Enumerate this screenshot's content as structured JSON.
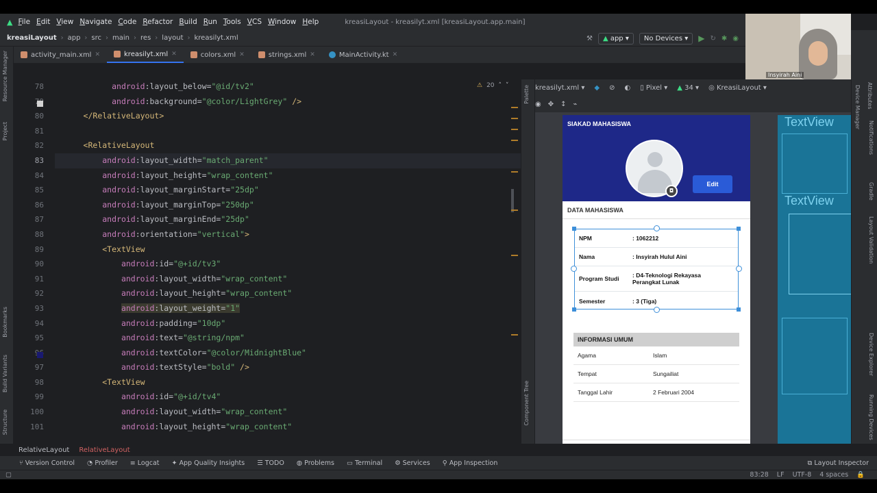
{
  "menu": [
    "File",
    "Edit",
    "View",
    "Navigate",
    "Code",
    "Refactor",
    "Build",
    "Run",
    "Tools",
    "VCS",
    "Window",
    "Help"
  ],
  "window_title": "kreasiLayout - kreasilyt.xml [kreasiLayout.app.main]",
  "breadcrumb": [
    "kreasiLayout",
    "app",
    "src",
    "main",
    "res",
    "layout",
    "kreasilyt.xml"
  ],
  "run": {
    "config": "app",
    "device": "No Devices"
  },
  "tabs": [
    {
      "label": "activity_main.xml",
      "color": "#cf8e6d"
    },
    {
      "label": "kreasilyt.xml",
      "color": "#cf8e6d"
    },
    {
      "label": "colors.xml",
      "color": "#cf8e6d"
    },
    {
      "label": "strings.xml",
      "color": "#cf8e6d"
    },
    {
      "label": "MainActivity.kt",
      "color": "#3592c4"
    }
  ],
  "left_tools": [
    "Resource Manager",
    "Project",
    "Bookmarks",
    "Build Variants",
    "Structure"
  ],
  "inspections": {
    "warnings": "20"
  },
  "line_numbers": [
    "78",
    "79",
    "80",
    "81",
    "82",
    "83",
    "84",
    "85",
    "86",
    "87",
    "88",
    "89",
    "90",
    "91",
    "92",
    "93",
    "94",
    "95",
    "96",
    "97",
    "98",
    "99",
    "100",
    "101"
  ],
  "code": {
    "l78": {
      "indent": "            ",
      "ns": "android",
      "attr": ":layout_below=",
      "val": "\"@id/tv2\""
    },
    "l79": {
      "indent": "            ",
      "ns": "android",
      "attr": ":background=",
      "val": "\"@color/LightGrey\"",
      "tail": " />"
    },
    "l80": {
      "indent": "      ",
      "tag": "</RelativeLayout>"
    },
    "l82": {
      "indent": "      ",
      "tag": "<RelativeLayout"
    },
    "l83": {
      "indent": "          ",
      "ns": "android",
      "attr": ":layout_width=",
      "val": "\"match_parent\""
    },
    "l84": {
      "indent": "          ",
      "ns": "android",
      "attr": ":layout_height=",
      "val": "\"wrap_content\""
    },
    "l85": {
      "indent": "          ",
      "ns": "android",
      "attr": ":layout_marginStart=",
      "val": "\"25dp\""
    },
    "l86": {
      "indent": "          ",
      "ns": "android",
      "attr": ":layout_marginTop=",
      "val": "\"250dp\""
    },
    "l87": {
      "indent": "          ",
      "ns": "android",
      "attr": ":layout_marginEnd=",
      "val": "\"25dp\""
    },
    "l88": {
      "indent": "          ",
      "ns": "android",
      "attr": ":orientation=",
      "val": "\"vertical\"",
      "tail": ">"
    },
    "l89": {
      "indent": "          ",
      "tag": "<TextView"
    },
    "l90": {
      "indent": "              ",
      "ns": "android",
      "attr": ":id=",
      "val": "\"@+id/tv3\""
    },
    "l91": {
      "indent": "              ",
      "ns": "android",
      "attr": ":layout_width=",
      "val": "\"wrap_content\""
    },
    "l92": {
      "indent": "              ",
      "ns": "android",
      "attr": ":layout_height=",
      "val": "\"wrap_content\""
    },
    "l93": {
      "indent": "              ",
      "ns": "android",
      "attr": ":layout_weight=",
      "val": "\"1\""
    },
    "l94": {
      "indent": "              ",
      "ns": "android",
      "attr": ":padding=",
      "val": "\"10dp\""
    },
    "l95": {
      "indent": "              ",
      "ns": "android",
      "attr": ":text=",
      "val": "\"@string/npm\""
    },
    "l96": {
      "indent": "              ",
      "ns": "android",
      "attr": ":textColor=",
      "val": "\"@color/MidnightBlue\""
    },
    "l97": {
      "indent": "              ",
      "ns": "android",
      "attr": ":textStyle=",
      "val": "\"bold\"",
      "tail": " />"
    },
    "l98": {
      "indent": "          ",
      "tag": "<TextView"
    },
    "l99": {
      "indent": "              ",
      "ns": "android",
      "attr": ":id=",
      "val": "\"@+id/tv4\""
    },
    "l100": {
      "indent": "              ",
      "ns": "android",
      "attr": ":layout_width=",
      "val": "\"wrap_content\""
    },
    "l101": {
      "indent": "              ",
      "ns": "android",
      "attr": ":layout_height=",
      "val": "\"wrap_content\""
    }
  },
  "design_toolbar": {
    "file": "kreasilyt.xml",
    "device": "Pixel",
    "api": "34",
    "theme": "KreasiLayout"
  },
  "design_tools": [
    "Palette",
    "Component Tree"
  ],
  "phone": {
    "appbar": "SIAKAD MAHASISWA",
    "edit_label": "Edit",
    "section1": "DATA MAHASISWA",
    "student": [
      {
        "k": "NPM",
        "v": ": 1062212"
      },
      {
        "k": "Nama",
        "v": ": Insyirah Hulul Aini"
      },
      {
        "k": "Program Studi",
        "v": ": D4-Teknologi Rekayasa Perangkat Lunak"
      },
      {
        "k": "Semester",
        "v": ": 3 (Tiga)"
      }
    ],
    "info_title": "INFORMASI UMUM",
    "info": [
      {
        "k": "Agama",
        "v": "Islam"
      },
      {
        "k": "Tempat",
        "v": "Sungailiat"
      },
      {
        "k": "Tanggal Lahir",
        "v": "2 Februari 2004"
      }
    ]
  },
  "blueprint": {
    "label": "TextView"
  },
  "right_tools": [
    "Gradle",
    "Notifications",
    "Layout Validation",
    "Device Explorer",
    "Running Devices",
    "Attributes",
    "Device Manager"
  ],
  "webcam_name": "Insyirah Aini",
  "code_breadcrumb": [
    "RelativeLayout",
    "RelativeLayout"
  ],
  "bottom_tools": [
    "Version Control",
    "Profiler",
    "Logcat",
    "App Quality Insights",
    "TODO",
    "Problems",
    "Terminal",
    "Services",
    "App Inspection"
  ],
  "layout_inspector": "Layout Inspector",
  "status": {
    "pos": "83:28",
    "le": "LF",
    "enc": "UTF-8",
    "indent": "4 spaces"
  },
  "colors": {
    "accent": "#3574f0",
    "appbar": "#1e2888",
    "edit": "#2a5bd7",
    "blueprint": "#1a7497"
  }
}
